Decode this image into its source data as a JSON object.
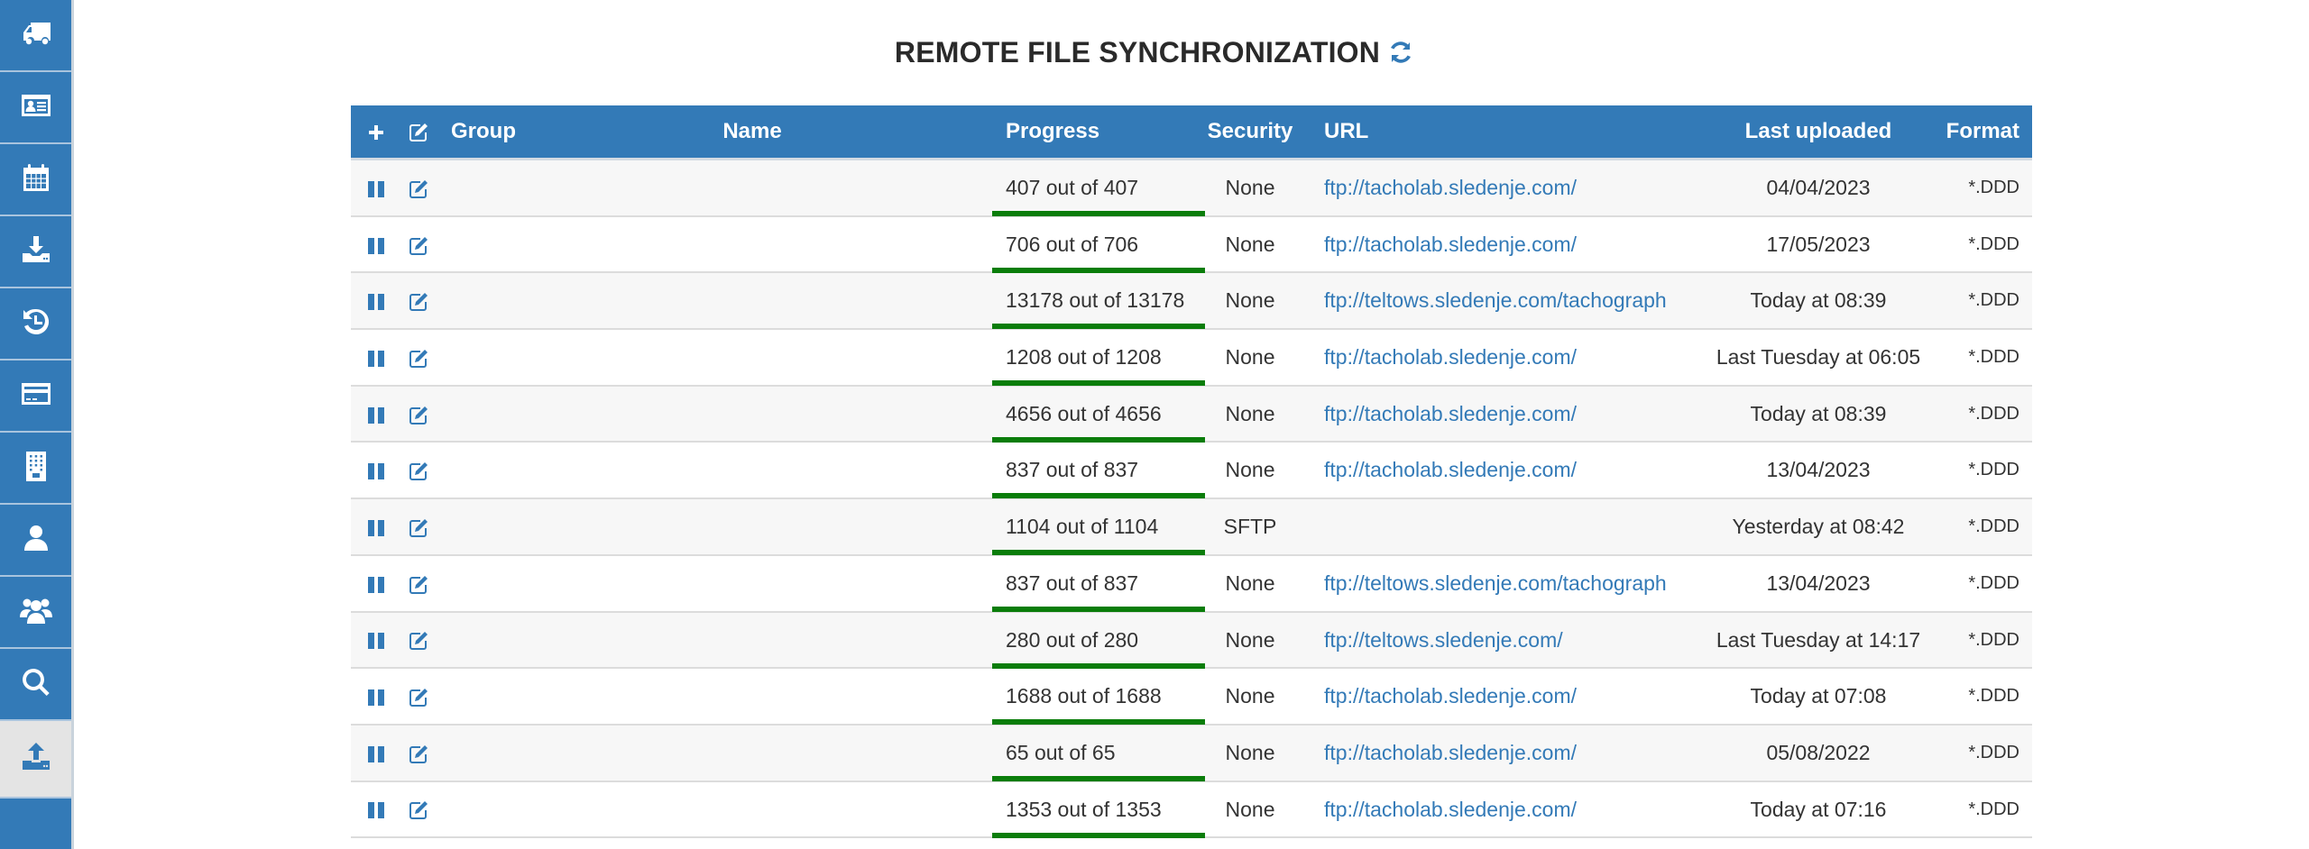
{
  "colors": {
    "brand_blue": "#337ab7",
    "progress_green": "#0a7d0a",
    "link": "#337ab7",
    "active_sidebar_bg": "#e4e4e4"
  },
  "sidebar": {
    "items": [
      {
        "id": "vehicles",
        "icon": "truck-icon",
        "active": false
      },
      {
        "id": "drivers",
        "icon": "id-card-icon",
        "active": false
      },
      {
        "id": "calendar",
        "icon": "calendar-icon",
        "active": false
      },
      {
        "id": "download",
        "icon": "download-tray-icon",
        "active": false
      },
      {
        "id": "history",
        "icon": "history-icon",
        "active": false
      },
      {
        "id": "payment",
        "icon": "credit-card-icon",
        "active": false
      },
      {
        "id": "company",
        "icon": "building-icon",
        "active": false
      },
      {
        "id": "user",
        "icon": "user-icon",
        "active": false
      },
      {
        "id": "users",
        "icon": "users-group-icon",
        "active": false
      },
      {
        "id": "search",
        "icon": "search-icon",
        "active": false
      },
      {
        "id": "upload",
        "icon": "upload-tray-icon",
        "active": true
      }
    ]
  },
  "page": {
    "title": "REMOTE FILE SYNCHRONIZATION",
    "refresh_icon": "refresh-icon"
  },
  "table": {
    "header": {
      "add_icon": "plus-icon",
      "edit_icon": "edit-icon",
      "group": "Group",
      "name": "Name",
      "progress": "Progress",
      "security": "Security",
      "url": "URL",
      "last_uploaded": "Last uploaded",
      "format": "Format"
    },
    "rows": [
      {
        "group": "",
        "name": "",
        "progress_text": "407 out of 407",
        "progress_done": 407,
        "progress_total": 407,
        "security": "None",
        "url": "ftp://tacholab.sledenje.com/",
        "last_uploaded": "04/04/2023",
        "format": "*.DDD"
      },
      {
        "group": "",
        "name": "",
        "progress_text": "706 out of 706",
        "progress_done": 706,
        "progress_total": 706,
        "security": "None",
        "url": "ftp://tacholab.sledenje.com/",
        "last_uploaded": "17/05/2023",
        "format": "*.DDD"
      },
      {
        "group": "",
        "name": "",
        "progress_text": "13178 out of 13178",
        "progress_done": 13178,
        "progress_total": 13178,
        "security": "None",
        "url": "ftp://teltows.sledenje.com/tachograph",
        "last_uploaded": "Today at 08:39",
        "format": "*.DDD"
      },
      {
        "group": "",
        "name": "",
        "progress_text": "1208 out of 1208",
        "progress_done": 1208,
        "progress_total": 1208,
        "security": "None",
        "url": "ftp://tacholab.sledenje.com/",
        "last_uploaded": "Last Tuesday at 06:05",
        "format": "*.DDD"
      },
      {
        "group": "",
        "name": "",
        "progress_text": "4656 out of 4656",
        "progress_done": 4656,
        "progress_total": 4656,
        "security": "None",
        "url": "ftp://tacholab.sledenje.com/",
        "last_uploaded": "Today at 08:39",
        "format": "*.DDD"
      },
      {
        "group": "",
        "name": "",
        "progress_text": "837 out of 837",
        "progress_done": 837,
        "progress_total": 837,
        "security": "None",
        "url": "ftp://tacholab.sledenje.com/",
        "last_uploaded": "13/04/2023",
        "format": "*.DDD"
      },
      {
        "group": "",
        "name": "",
        "progress_text": "1104 out of 1104",
        "progress_done": 1104,
        "progress_total": 1104,
        "security": "SFTP",
        "url": "",
        "last_uploaded": "Yesterday at 08:42",
        "format": "*.DDD"
      },
      {
        "group": "",
        "name": "",
        "progress_text": "837 out of 837",
        "progress_done": 837,
        "progress_total": 837,
        "security": "None",
        "url": "ftp://teltows.sledenje.com/tachograph",
        "last_uploaded": "13/04/2023",
        "format": "*.DDD"
      },
      {
        "group": "",
        "name": "",
        "progress_text": "280 out of 280",
        "progress_done": 280,
        "progress_total": 280,
        "security": "None",
        "url": "ftp://teltows.sledenje.com/",
        "last_uploaded": "Last Tuesday at 14:17",
        "format": "*.DDD"
      },
      {
        "group": "",
        "name": "",
        "progress_text": "1688 out of 1688",
        "progress_done": 1688,
        "progress_total": 1688,
        "security": "None",
        "url": "ftp://tacholab.sledenje.com/",
        "last_uploaded": "Today at 07:08",
        "format": "*.DDD"
      },
      {
        "group": "",
        "name": "",
        "progress_text": "65 out of 65",
        "progress_done": 65,
        "progress_total": 65,
        "security": "None",
        "url": "ftp://tacholab.sledenje.com/",
        "last_uploaded": "05/08/2022",
        "format": "*.DDD"
      },
      {
        "group": "",
        "name": "",
        "progress_text": "1353 out of 1353",
        "progress_done": 1353,
        "progress_total": 1353,
        "security": "None",
        "url": "ftp://tacholab.sledenje.com/",
        "last_uploaded": "Today at 07:16",
        "format": "*.DDD"
      }
    ]
  }
}
